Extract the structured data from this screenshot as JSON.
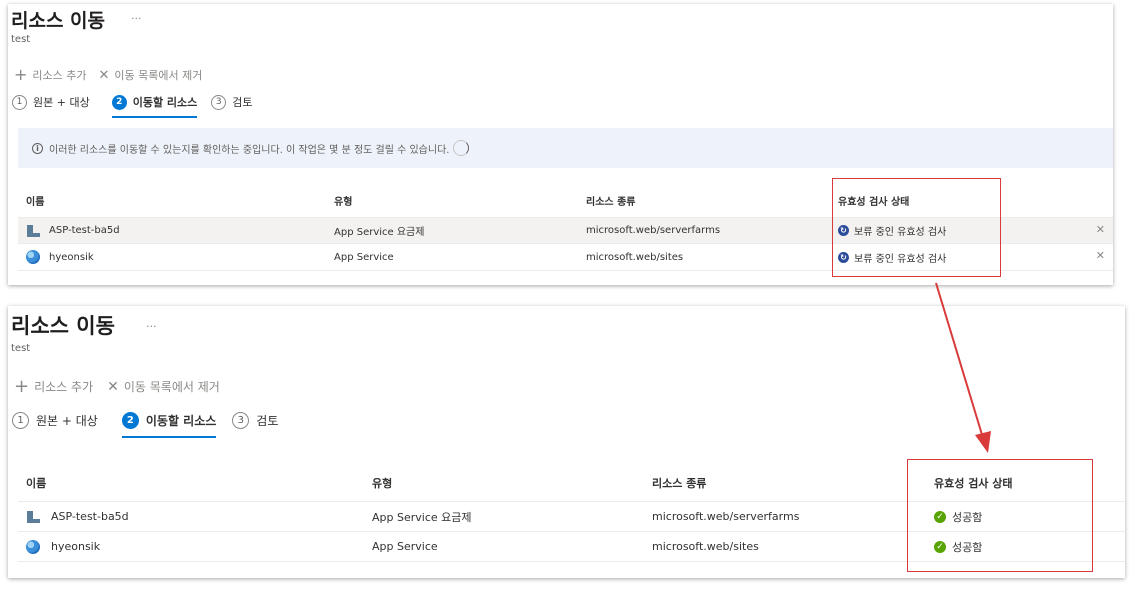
{
  "panels": [
    {
      "title": "리소스 이동",
      "ellipsis": "···",
      "subtitle": "test",
      "toolbar": {
        "add_label": "리소스 추가",
        "remove_label": "이동 목록에서 제거"
      },
      "steps": [
        {
          "num": "1",
          "label": "원본 + 대상"
        },
        {
          "num": "2",
          "label": "이동할 리소스"
        },
        {
          "num": "3",
          "label": "검토"
        }
      ],
      "info_message": "이러한 리소스를 이동할 수 있는지를 확인하는 중입니다. 이 작업은 몇 분 정도 걸릴 수 있습니다.",
      "columns": [
        "이름",
        "유형",
        "리소스 종류",
        "유효성 검사 상태"
      ],
      "rows": [
        {
          "name": "ASP-test-ba5d",
          "type": "App Service 요금제",
          "kind": "microsoft.web/serverfarms",
          "status": "보류 중인 유효성 검사"
        },
        {
          "name": "hyeonsik",
          "type": "App Service",
          "kind": "microsoft.web/sites",
          "status": "보류 중인 유효성 검사"
        }
      ]
    },
    {
      "title": "리소스 이동",
      "ellipsis": "···",
      "subtitle": "test",
      "toolbar": {
        "add_label": "리소스 추가",
        "remove_label": "이동 목록에서 제거"
      },
      "steps": [
        {
          "num": "1",
          "label": "원본 + 대상"
        },
        {
          "num": "2",
          "label": "이동할 리소스"
        },
        {
          "num": "3",
          "label": "검토"
        }
      ],
      "columns": [
        "이름",
        "유형",
        "리소스 종류",
        "유효성 검사 상태"
      ],
      "rows": [
        {
          "name": "ASP-test-ba5d",
          "type": "App Service 요금제",
          "kind": "microsoft.web/serverfarms",
          "status": "성공함"
        },
        {
          "name": "hyeonsik",
          "type": "App Service",
          "kind": "microsoft.web/sites",
          "status": "성공함"
        }
      ]
    }
  ],
  "icons": {
    "add": "plus-icon",
    "remove": "close-icon",
    "info": "info-icon",
    "pending": "pending-validation-icon",
    "success": "success-check-icon",
    "plan": "app-service-plan-icon",
    "site": "app-service-globe-icon"
  },
  "colors": {
    "accent": "#0078d4",
    "annotation": "#d93a3a",
    "success": "#57a300",
    "pending": "#2b4b9b",
    "info_bg": "#eef3fb"
  }
}
